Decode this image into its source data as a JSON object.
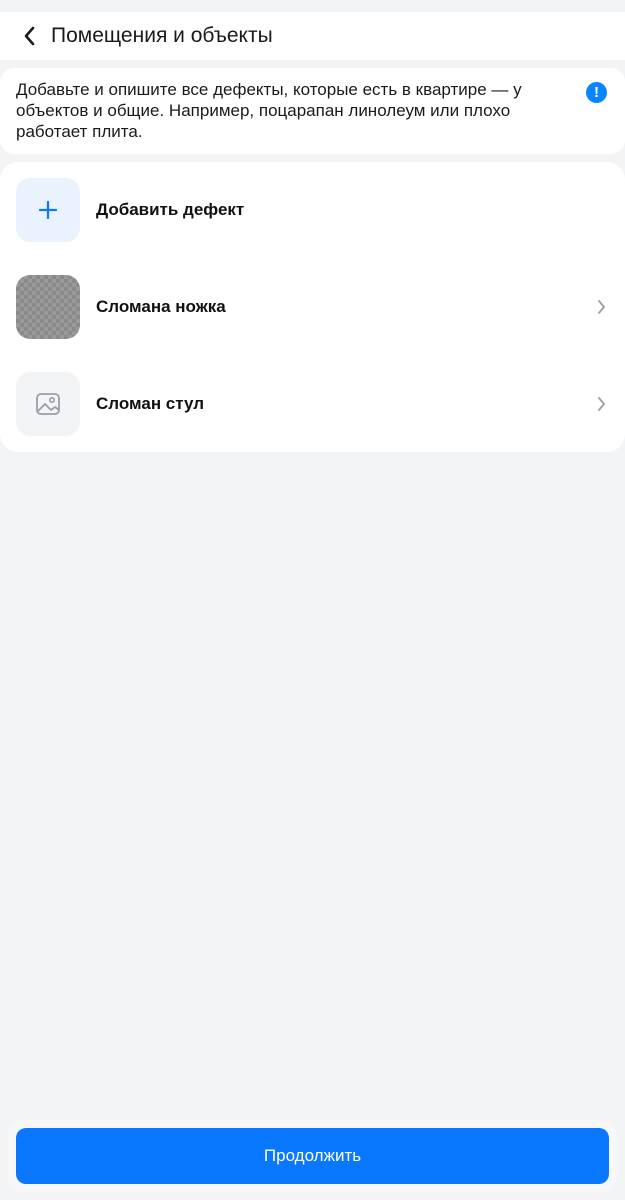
{
  "header": {
    "title": "Помещения и объекты",
    "back_icon": "chevron-left-icon"
  },
  "info": {
    "text": "Добавьте и опишите все дефекты, которые есть в квартире — у объектов и общие. Например, поцарапан линолеум или плохо работает плита.",
    "icon": "exclamation-icon",
    "icon_glyph": "!",
    "accent_color": "#0a84ff"
  },
  "list": {
    "add_label": "Добавить дефект",
    "items": [
      {
        "label": "Сломана ножка",
        "thumb": "photo"
      },
      {
        "label": "Сломан стул",
        "thumb": "image-placeholder-icon"
      }
    ]
  },
  "footer": {
    "continue_label": "Продолжить",
    "button_color": "#0a77ff"
  }
}
